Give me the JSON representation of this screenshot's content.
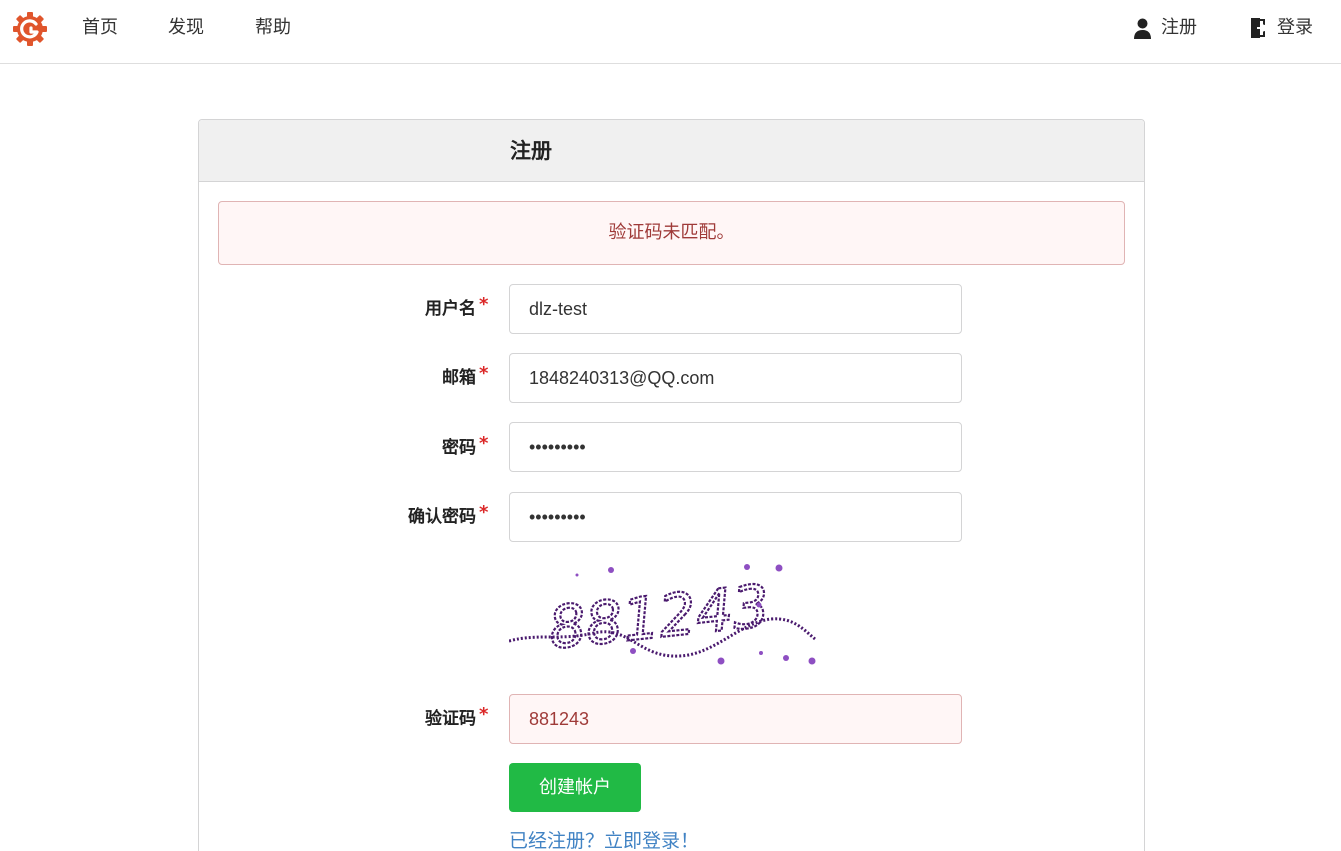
{
  "nav": {
    "home": "首页",
    "explore": "发现",
    "help": "帮助",
    "register": "注册",
    "login": "登录"
  },
  "form": {
    "title": "注册",
    "alert": "验证码未匹配。",
    "fields": {
      "username": {
        "label": "用户名",
        "value": "dlz-test"
      },
      "email": {
        "label": "邮箱",
        "value": "1848240313@QQ.com"
      },
      "password": {
        "label": "密码",
        "value": "123456789"
      },
      "retype": {
        "label": "确认密码",
        "value": "123456789"
      },
      "captcha": {
        "label": "验证码",
        "value": "881243"
      }
    },
    "required_mark": "*",
    "captcha_image_text": "881243",
    "submit": "创建帐户",
    "login_link": "已经注册？立即登录！"
  },
  "colors": {
    "accent_green": "#21ba45",
    "error_red": "#9f3a38",
    "error_bg": "#fff6f6",
    "link_blue": "#4183c4",
    "logo_orange": "#e0552c",
    "captcha_purple": "#4a1a6e"
  },
  "icons": {
    "logo": "gitea-logo-icon",
    "register": "user-icon",
    "login": "sign-in-door-icon"
  }
}
